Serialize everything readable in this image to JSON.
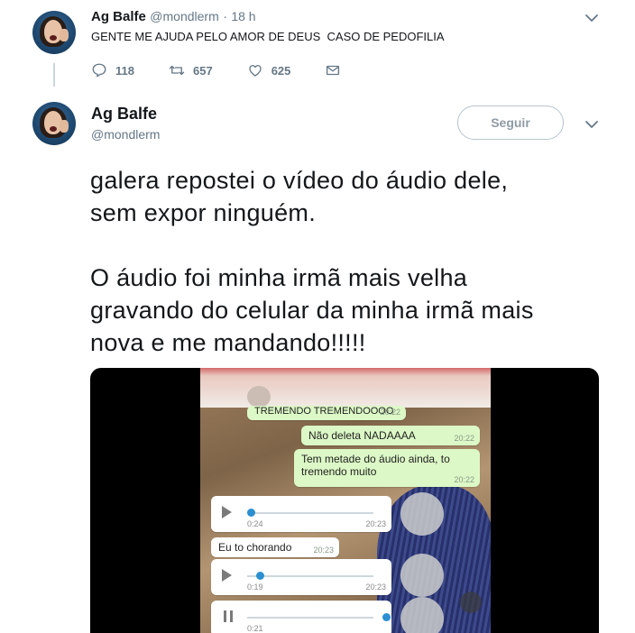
{
  "parent_tweet": {
    "name": "Ag Balfe",
    "handle": "@mondlerm",
    "separator": "·",
    "time": "18 h",
    "text": "GENTE ME AJUDA PELO AMOR DE DEUS  CASO DE PEDOFILIA",
    "replies": "118",
    "retweets": "657",
    "likes": "625"
  },
  "main_tweet": {
    "name": "Ag Balfe",
    "handle": "@mondlerm",
    "follow_label": "Seguir",
    "text_line_1": "galera repostei o vídeo do áudio dele,",
    "text_line_2": "sem expor ninguém.",
    "text_line_3": "O áudio foi minha irmã mais velha",
    "text_line_4": "gravando do celular da minha irmã mais",
    "text_line_5": "nova e me mandando!!!!!"
  },
  "video": {
    "top_bubble": "TREMENDO TREMENDOOOO",
    "top_bubble_time": "20:22",
    "bubble_1": "Não deleta NADAAAA",
    "bubble_1_time": "20:22",
    "bubble_2_line1": "Tem metade do áudio ainda, to",
    "bubble_2_line2": "tremendo muito",
    "bubble_2_time": "20:22",
    "audio_1_duration": "0:24",
    "audio_1_time": "20:23",
    "bubble_3": "Eu to chorando",
    "bubble_3_time": "20:23",
    "audio_2_duration": "0:19",
    "audio_2_time": "20:23",
    "audio_3_duration": "0:21"
  },
  "colors": {
    "link_blue": "#1da1f2",
    "muted": "#657786",
    "whatsapp_out": "#dcf8c6"
  }
}
